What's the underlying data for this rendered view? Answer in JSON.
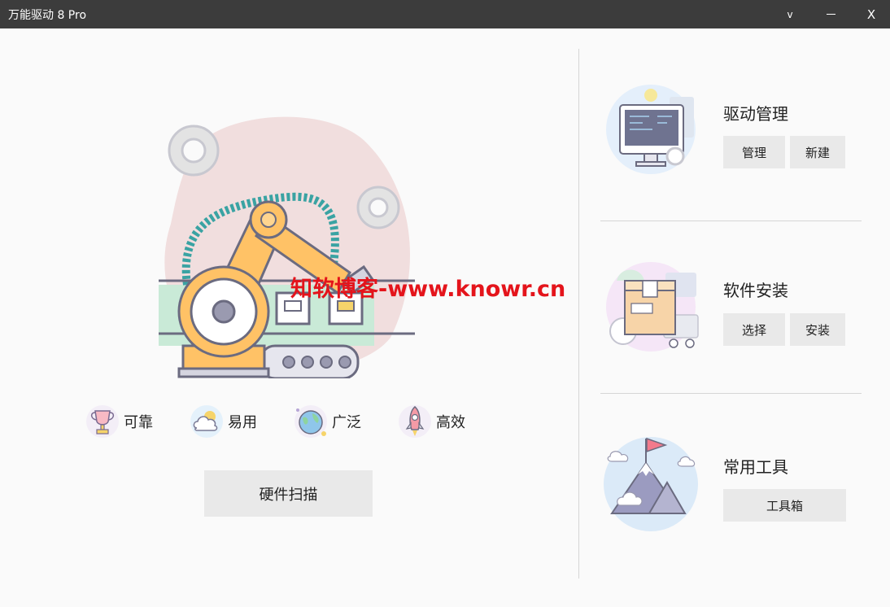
{
  "window": {
    "title": "万能驱动 8 Pro",
    "menu_glyph": "v",
    "close_glyph": "X"
  },
  "watermark": "知软博客-www.knowr.cn",
  "features": [
    {
      "label": "可靠",
      "icon": "trophy-icon"
    },
    {
      "label": "易用",
      "icon": "cloud-icon"
    },
    {
      "label": "广泛",
      "icon": "globe-icon"
    },
    {
      "label": "高效",
      "icon": "rocket-icon"
    }
  ],
  "scan_button": "硬件扫描",
  "cards": [
    {
      "title": "驱动管理",
      "buttons": [
        "管理",
        "新建"
      ]
    },
    {
      "title": "软件安装",
      "buttons": [
        "选择",
        "安装"
      ]
    },
    {
      "title": "常用工具",
      "buttons": [
        "工具箱"
      ]
    }
  ],
  "colors": {
    "titlebar": "#3c3c3c",
    "background": "#fafafa",
    "button": "#e9e9e9",
    "watermark": "#e4141b",
    "robot_arm": "#ffc266"
  }
}
